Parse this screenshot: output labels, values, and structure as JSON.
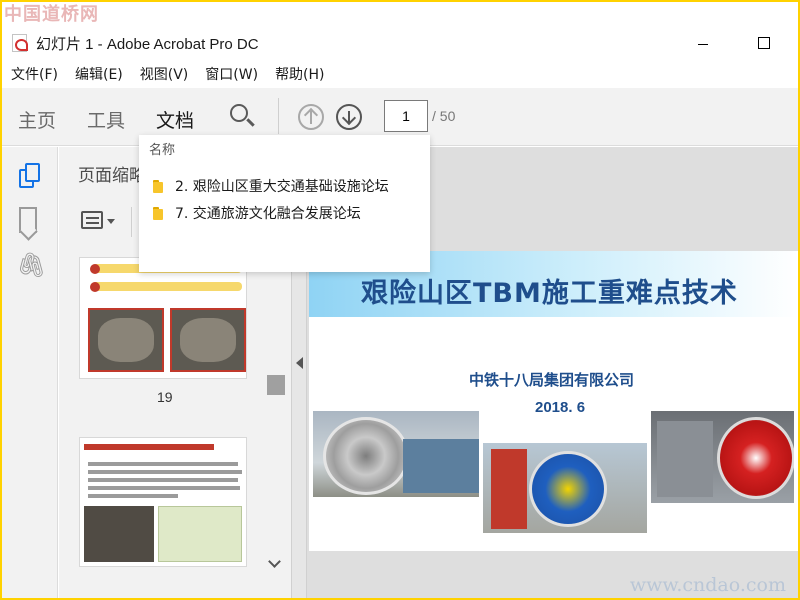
{
  "watermarks": {
    "top": "中国道桥网",
    "bottom": "www.cndao.com"
  },
  "window": {
    "title": "幻灯片 1 - Adobe Acrobat Pro DC"
  },
  "menu": [
    "文件(F)",
    "编辑(E)",
    "视图(V)",
    "窗口(W)",
    "帮助(H)"
  ],
  "toolbar": {
    "tabs": [
      "主页",
      "工具",
      "文档"
    ],
    "current_page": "1",
    "total_pages": "/ 50"
  },
  "sidebar": {
    "panel_title": "页面缩略图",
    "thumbnail_label": "19"
  },
  "dropdown": {
    "header": "名称",
    "items": [
      "2. 艰险山区重大交通基础设施论坛",
      "7. 交通旅游文化融合发展论坛"
    ]
  },
  "slide": {
    "title": "艰险山区TBM施工重难点技术",
    "company": "中铁十八局集团有限公司",
    "date": "2018. 6"
  },
  "colors": {
    "accent": "#1473e6",
    "slide_title": "#1f4e8c",
    "frame": "#ffd200"
  },
  "icons": [
    "pdf-icon",
    "search-icon",
    "arrow-up-icon",
    "arrow-down-icon",
    "pages-icon",
    "bookmark-icon",
    "attachment-icon",
    "folder-icon",
    "list-options-icon",
    "chevron-down-icon",
    "chevron-left-icon"
  ]
}
